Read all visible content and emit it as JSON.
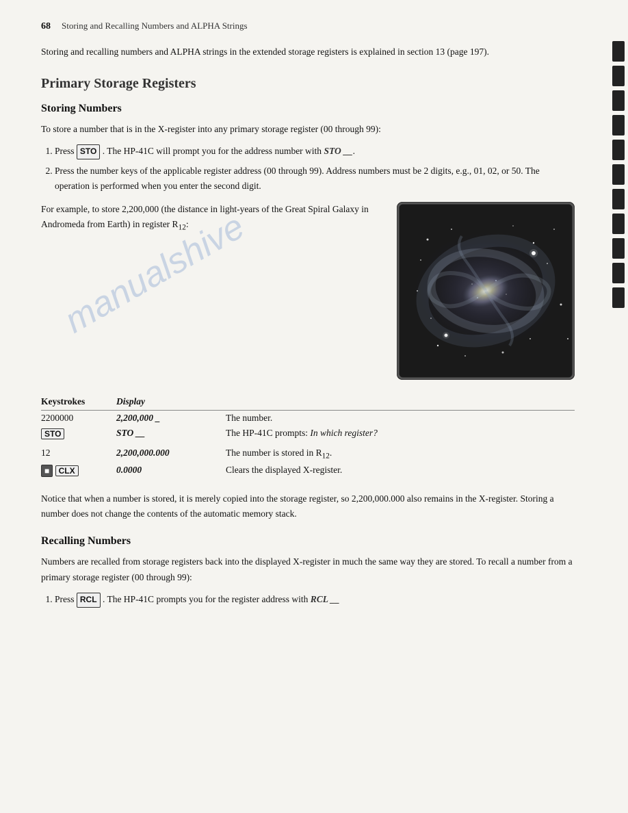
{
  "page": {
    "number": "68",
    "header_title": "Storing and Recalling Numbers and ALPHA Strings"
  },
  "intro": {
    "text": "Storing and recalling numbers and ALPHA strings in the extended storage registers is explained in section 13 (page 197)."
  },
  "primary_storage": {
    "section_title": "Primary Storage Registers",
    "storing_numbers": {
      "subsection_title": "Storing Numbers",
      "intro_text": "To store a number that is in the X-register into any primary storage register (00 through 99):",
      "steps": [
        {
          "id": 1,
          "text_before": "Press",
          "key": "STO",
          "text_after": ". The HP-41C will prompt you for the address number with",
          "display_code": "STO __",
          "display_code_suffix": "."
        },
        {
          "id": 2,
          "text": "Press the number keys of the applicable register address (00 through 99). Address numbers must be 2 digits, e.g., 01, 02, or 50. The operation is performed when you enter the second digit."
        }
      ]
    },
    "example_text": "For example, to store 2,200,000 (the distance in light-years of the Great Spiral Galaxy in Andromeda from Earth) in register R",
    "example_subscript": "12",
    "example_suffix": ":",
    "keystrokes": {
      "headers": {
        "keystroke": "Keystrokes",
        "display": "Display"
      },
      "rows": [
        {
          "keystroke": "2200000",
          "display": "2,200,000 _",
          "description": "The number.",
          "key_box": false
        },
        {
          "keystroke": "STO",
          "display": "STO __",
          "description": "The HP-41C prompts: In which register?",
          "key_box": true,
          "desc_italic": "In which register?"
        },
        {
          "keystroke": "12",
          "display": "2,200,000.000",
          "description": "The number is stored in R",
          "description_sub": "12",
          "description_suffix": ".",
          "key_box": false
        },
        {
          "keystroke": "CLX",
          "display": "0.0000",
          "description": "Clears the displayed X-register.",
          "key_box": true,
          "dark_key": true
        }
      ]
    },
    "notice_text": "Notice that when a number is stored, it is merely copied into the storage register, so 2,200,000.000 also remains in the X-register. Storing a number does not change the contents of the automatic memory stack.",
    "recalling_numbers": {
      "subsection_title": "Recalling Numbers",
      "intro_text": "Numbers are recalled from storage registers back into the displayed X-register in much the same way they are stored. To recall a number from a primary storage register (00 through 99):",
      "step1_text_before": "Press",
      "step1_key": "RCL",
      "step1_text_after": ". The HP-41C prompts you for the register address with",
      "step1_display": "RCL __"
    }
  },
  "watermark": "manualshive",
  "tabs": [
    {},
    {},
    {},
    {},
    {},
    {},
    {},
    {},
    {},
    {},
    {}
  ]
}
